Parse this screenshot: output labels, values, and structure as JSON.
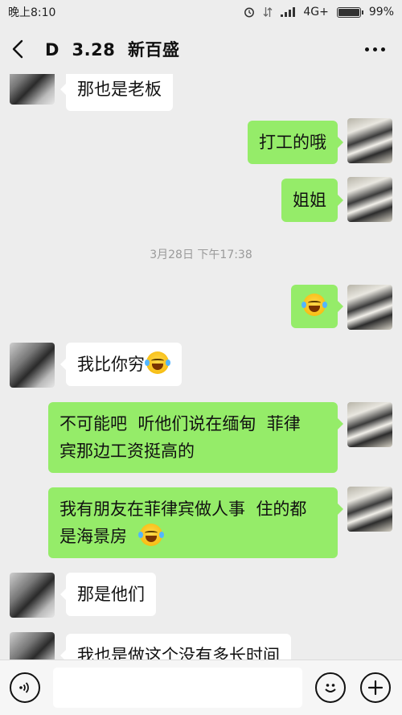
{
  "status_bar": {
    "time": "晚上8:10",
    "network": "4G+",
    "battery": "99%",
    "battery_level": 0.99
  },
  "header": {
    "title": "D  3.28  新百盛"
  },
  "messages": [
    {
      "side": "them",
      "text": "那也是老板"
    },
    {
      "side": "me",
      "text": "打工的哦"
    },
    {
      "side": "me",
      "text": "姐姐"
    },
    {
      "side": "time",
      "text": "3月28日 下午17:38"
    },
    {
      "side": "me",
      "emoji": "laughing-crying"
    },
    {
      "side": "them",
      "text": "我比你穷",
      "emoji": "crying"
    },
    {
      "side": "me",
      "line1": "不可能吧  听他们说在缅甸  菲律",
      "line2": "宾那边工资挺高的"
    },
    {
      "side": "me",
      "line1": "我有朋友在菲律宾做人事  住的都",
      "line2": "是海景房",
      "emoji": "laughing-crying"
    },
    {
      "side": "them",
      "text": "那是他们"
    },
    {
      "side": "them",
      "text": "我也是做这个没有多长时间"
    }
  ],
  "input": {
    "value": "",
    "placeholder": ""
  },
  "icons": {
    "back": "back-arrow-icon",
    "more": "more-icon",
    "voice": "voice-icon",
    "emoji": "emoji-icon",
    "plus": "plus-icon"
  }
}
